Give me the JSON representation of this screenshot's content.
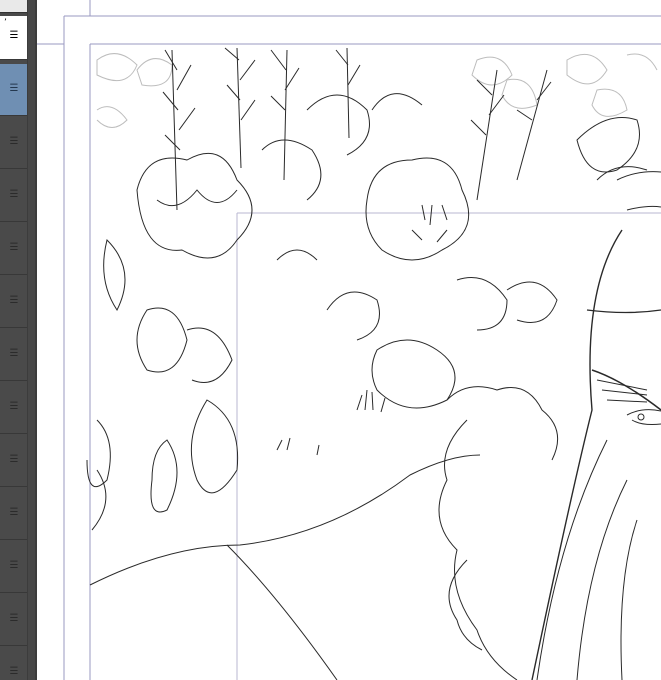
{
  "layers_panel": {
    "row_menu_glyph": "☰",
    "rows": [
      {
        "state": "white"
      },
      {
        "state": "active"
      },
      {
        "state": "normal"
      },
      {
        "state": "normal"
      },
      {
        "state": "normal"
      },
      {
        "state": "normal"
      },
      {
        "state": "normal"
      },
      {
        "state": "normal"
      },
      {
        "state": "normal"
      },
      {
        "state": "normal"
      },
      {
        "state": "normal"
      },
      {
        "state": "normal"
      },
      {
        "state": "normal"
      }
    ]
  },
  "canvas": {
    "content": "line-art illustration",
    "guide_color": "#9a98c0",
    "line_color": "#2a2a2a"
  }
}
